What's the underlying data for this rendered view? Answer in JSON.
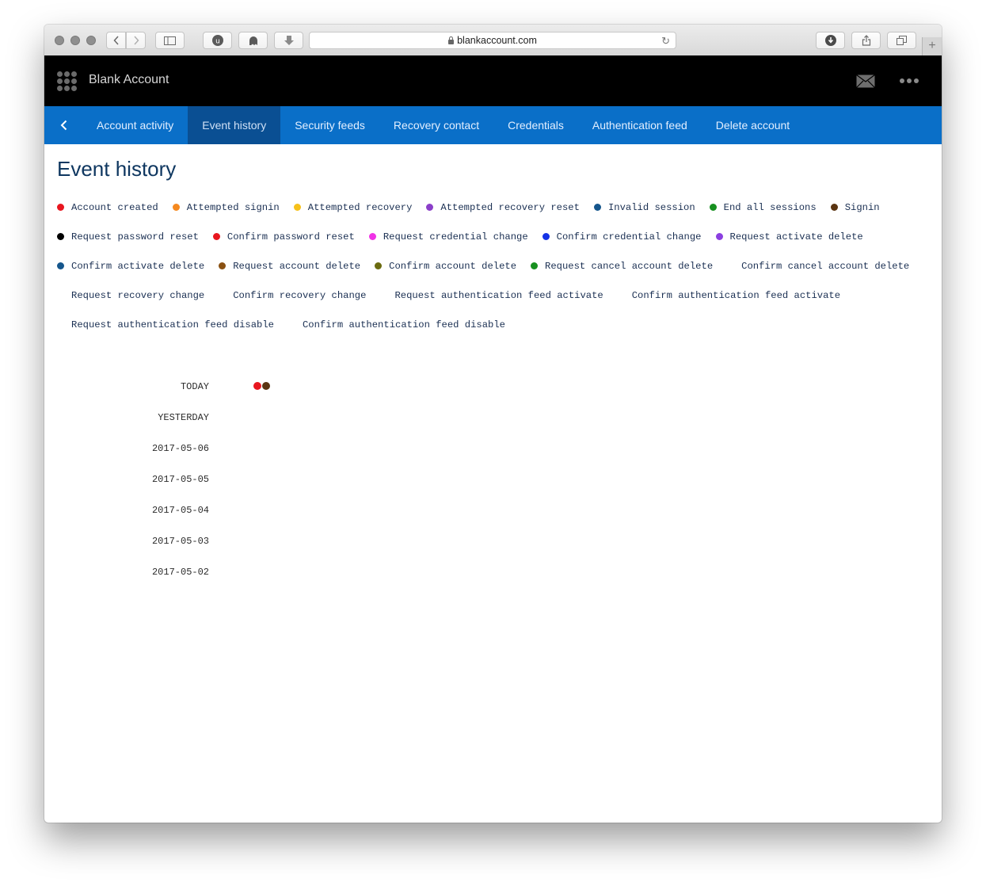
{
  "browser": {
    "url": "blankaccount.com"
  },
  "app": {
    "title": "Blank Account"
  },
  "nav": {
    "tabs": [
      {
        "label": "Account activity",
        "active": false
      },
      {
        "label": "Event history",
        "active": true
      },
      {
        "label": "Security feeds",
        "active": false
      },
      {
        "label": "Recovery contact",
        "active": false
      },
      {
        "label": "Credentials",
        "active": false
      },
      {
        "label": "Authentication feed",
        "active": false
      },
      {
        "label": "Delete account",
        "active": false
      }
    ]
  },
  "page": {
    "title": "Event history"
  },
  "legend": [
    [
      {
        "label": "Account created",
        "color": "#e8161f"
      },
      {
        "label": "Attempted signin",
        "color": "#f5891f"
      },
      {
        "label": "Attempted recovery",
        "color": "#f6c11a"
      },
      {
        "label": "Attempted recovery reset",
        "color": "#8b3fc9"
      },
      {
        "label": "Invalid session",
        "color": "#15568c"
      },
      {
        "label": "End all sessions",
        "color": "#17901f"
      },
      {
        "label": "Signin",
        "color": "#5a3411"
      }
    ],
    [
      {
        "label": "Request password reset",
        "color": "#000000"
      },
      {
        "label": "Confirm password reset",
        "color": "#e8161f"
      },
      {
        "label": "Request credential change",
        "color": "#f032e6"
      },
      {
        "label": "Confirm credential change",
        "color": "#1432e6"
      },
      {
        "label": "Request activate delete",
        "color": "#8b3fe0"
      }
    ],
    [
      {
        "label": "Confirm activate delete",
        "color": "#15568c"
      },
      {
        "label": "Request account delete",
        "color": "#8a5112"
      },
      {
        "label": "Confirm account delete",
        "color": "#6b6b10"
      },
      {
        "label": "Request cancel account delete",
        "color": "#17901f"
      },
      {
        "label": "Confirm cancel account delete",
        "color": ""
      }
    ],
    [
      {
        "label": "Request recovery change",
        "color": ""
      },
      {
        "label": "Confirm recovery change",
        "color": ""
      },
      {
        "label": "Request authentication feed activate",
        "color": ""
      },
      {
        "label": "Confirm authentication feed activate",
        "color": ""
      }
    ],
    [
      {
        "label": "Request authentication feed disable",
        "color": ""
      },
      {
        "label": "Confirm authentication feed disable",
        "color": ""
      }
    ]
  ],
  "timeline": [
    {
      "date": "TODAY",
      "events": [
        "#e8161f",
        "#5a3411"
      ]
    },
    {
      "date": "YESTERDAY",
      "events": []
    },
    {
      "date": "2017-05-06",
      "events": []
    },
    {
      "date": "2017-05-05",
      "events": []
    },
    {
      "date": "2017-05-04",
      "events": []
    },
    {
      "date": "2017-05-03",
      "events": []
    },
    {
      "date": "2017-05-02",
      "events": []
    }
  ]
}
